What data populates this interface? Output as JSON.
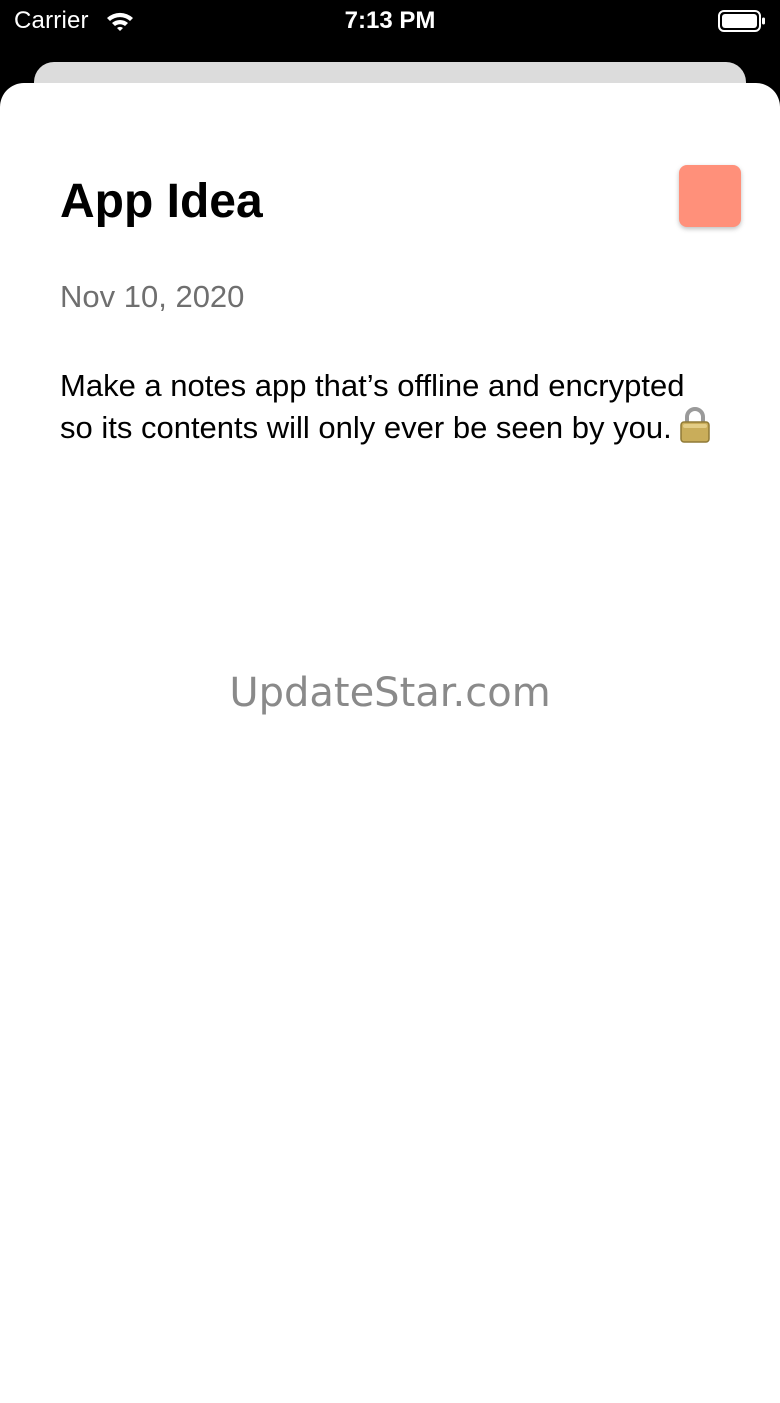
{
  "status_bar": {
    "carrier": "Carrier",
    "time": "7:13 PM",
    "icons": [
      "wifi-icon",
      "battery-icon"
    ]
  },
  "note": {
    "title": "App Idea",
    "date": "Nov 10, 2020",
    "body": "Make a notes app that’s offline and encrypted so its contents will only ever be seen by you.",
    "body_trailing_icon": "lock-icon",
    "color": "#ff907a"
  },
  "watermark": "UpdateStar.com"
}
